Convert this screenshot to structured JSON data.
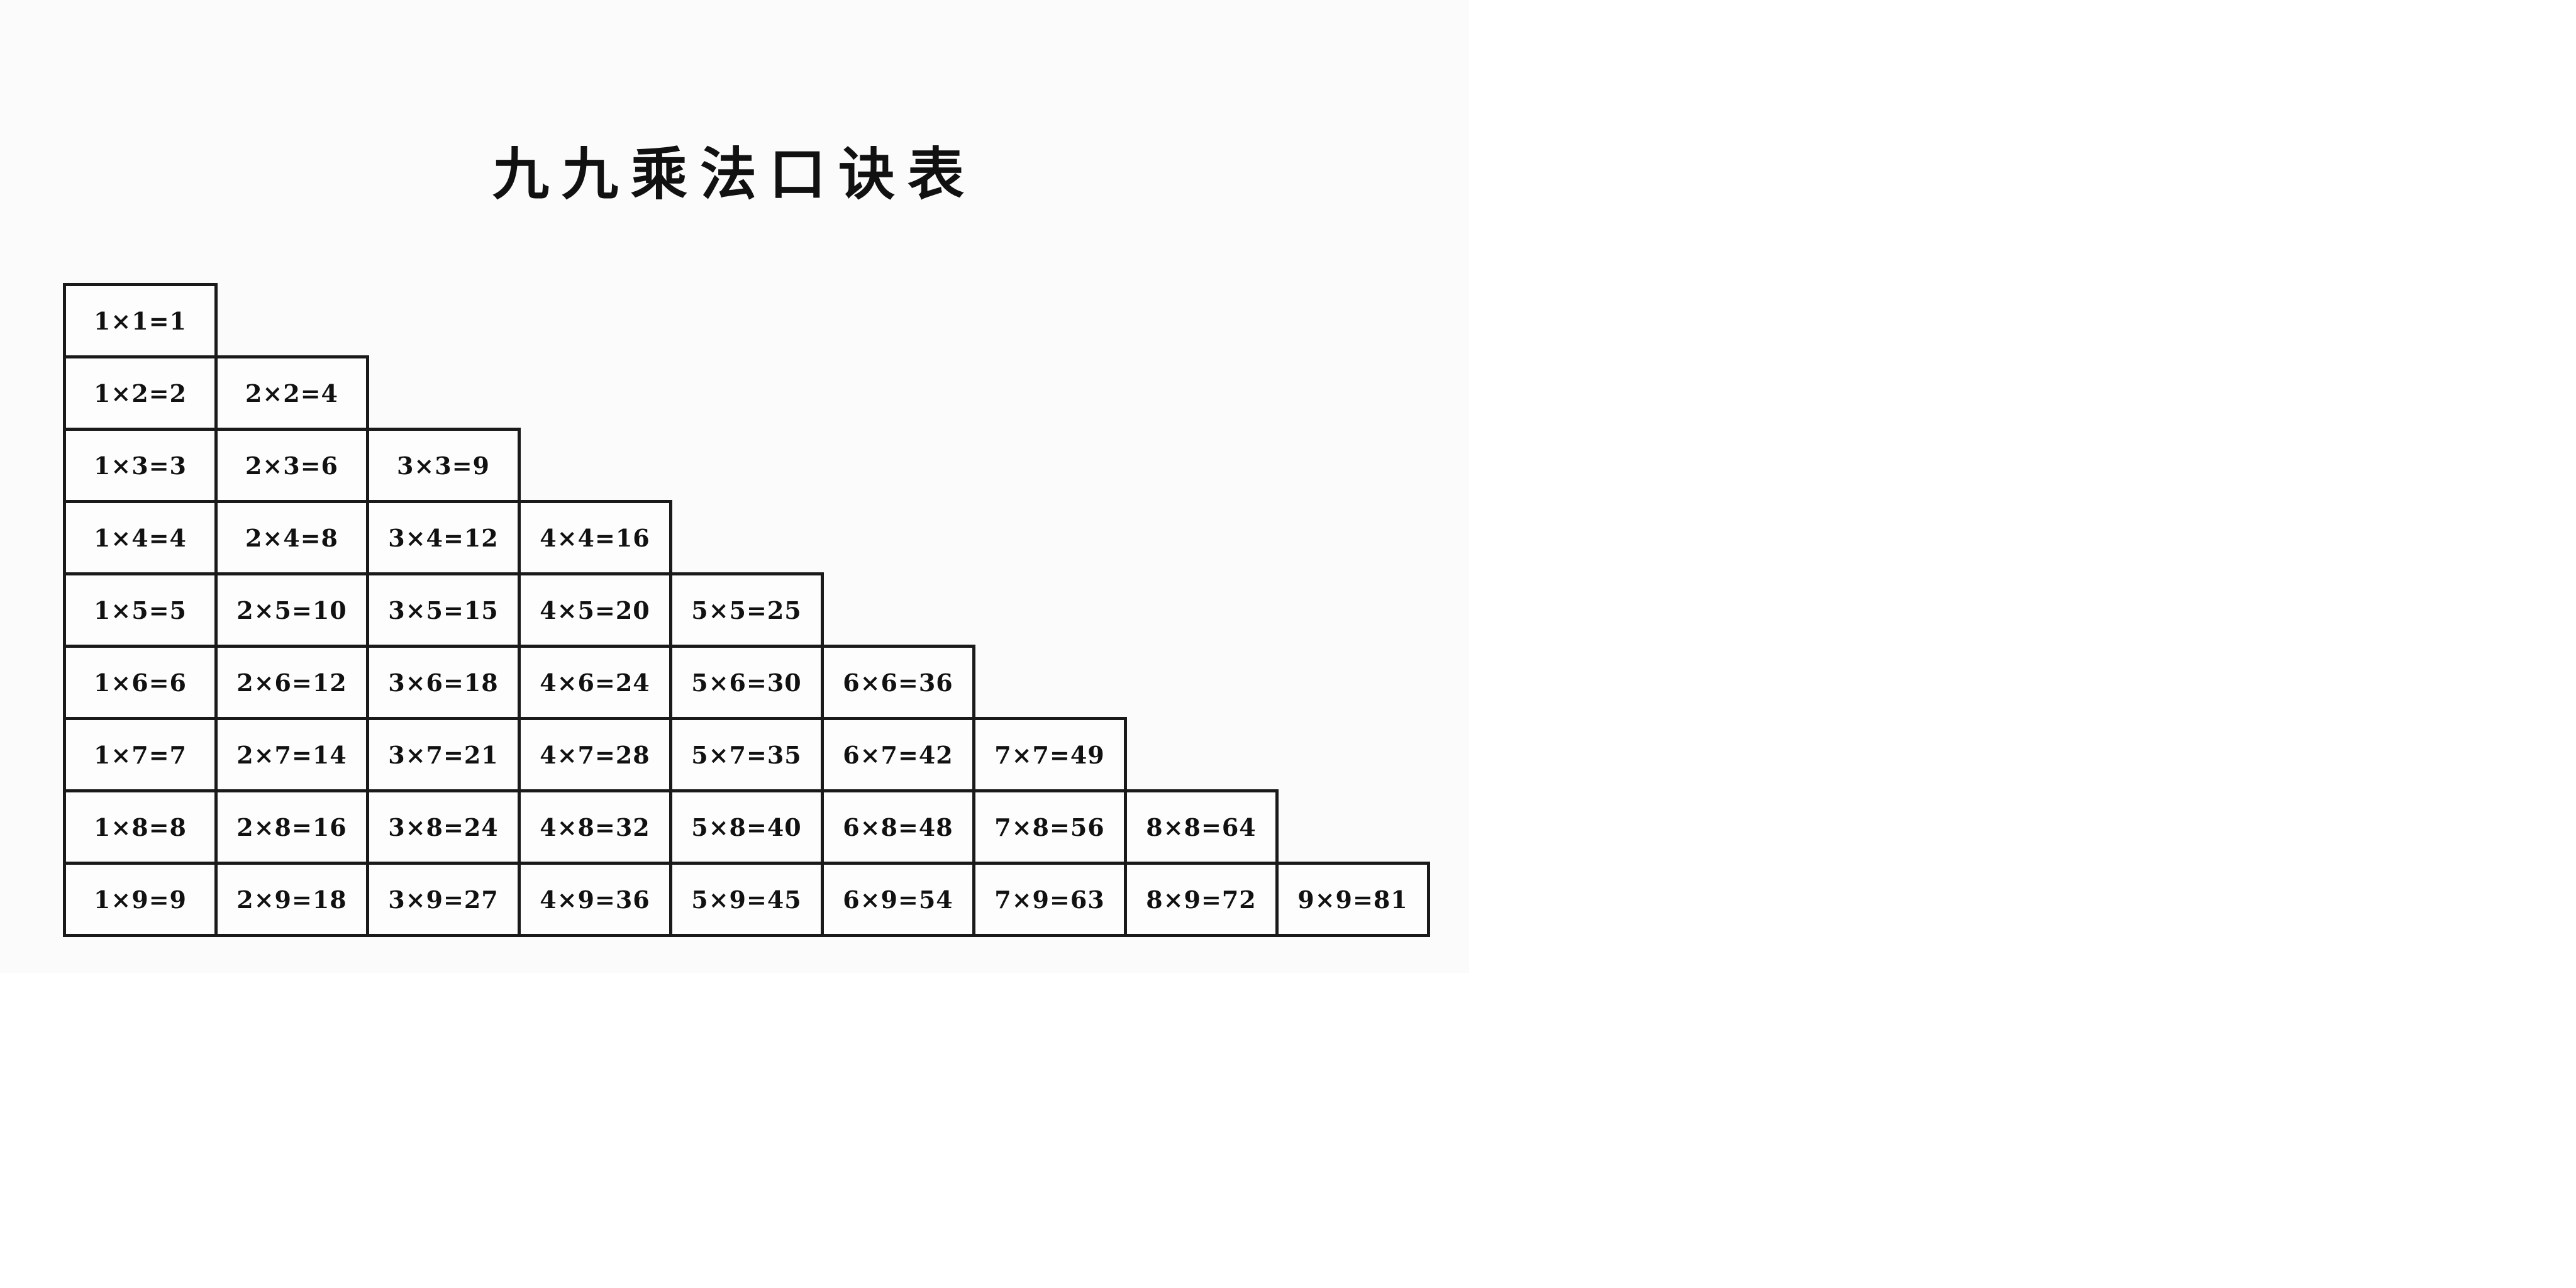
{
  "title": "九九乘法口诀表",
  "colors": {
    "border": "#1a1a1a",
    "text": "#111111",
    "sheet_background": "#fbfbfc",
    "page_background": "#ffffff"
  },
  "rows": [
    [
      "1×1=1"
    ],
    [
      "1×2=2",
      "2×2=4"
    ],
    [
      "1×3=3",
      "2×3=6",
      "3×3=9"
    ],
    [
      "1×4=4",
      "2×4=8",
      "3×4=12",
      "4×4=16"
    ],
    [
      "1×5=5",
      "2×5=10",
      "3×5=15",
      "4×5=20",
      "5×5=25"
    ],
    [
      "1×6=6",
      "2×6=12",
      "3×6=18",
      "4×6=24",
      "5×6=30",
      "6×6=36"
    ],
    [
      "1×7=7",
      "2×7=14",
      "3×7=21",
      "4×7=28",
      "5×7=35",
      "6×7=42",
      "7×7=49"
    ],
    [
      "1×8=8",
      "2×8=16",
      "3×8=24",
      "4×8=32",
      "5×8=40",
      "6×8=48",
      "7×8=56",
      "8×8=64"
    ],
    [
      "1×9=9",
      "2×9=18",
      "3×9=27",
      "4×9=36",
      "5×9=45",
      "6×9=54",
      "7×9=63",
      "8×9=72",
      "9×9=81"
    ]
  ]
}
